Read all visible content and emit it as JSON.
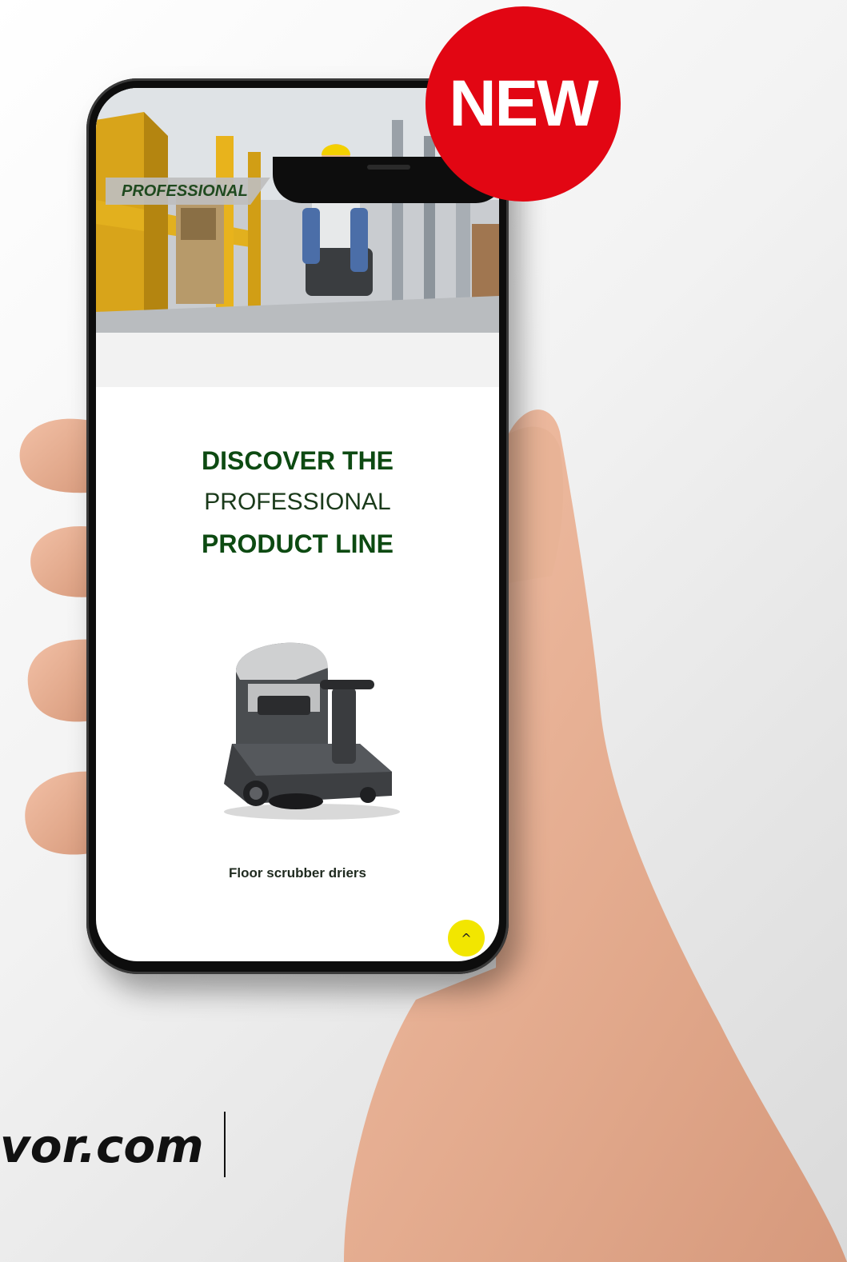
{
  "badge": {
    "label": "NEW",
    "color": "#e20613"
  },
  "hero": {
    "tag_label": "PROFESSIONAL"
  },
  "discover": {
    "line1": "DISCOVER THE",
    "line2": "PROFESSIONAL",
    "line3": "PRODUCT LINE"
  },
  "product": {
    "caption": "Floor scrubber driers"
  },
  "scroll_top": {
    "icon": "chevron-up-icon",
    "glyph": "^"
  },
  "footer": {
    "url_text": "vor.com"
  },
  "colors": {
    "accent_green": "#0d4a12",
    "button_yellow": "#f2e600",
    "brand_red": "#e20613"
  }
}
